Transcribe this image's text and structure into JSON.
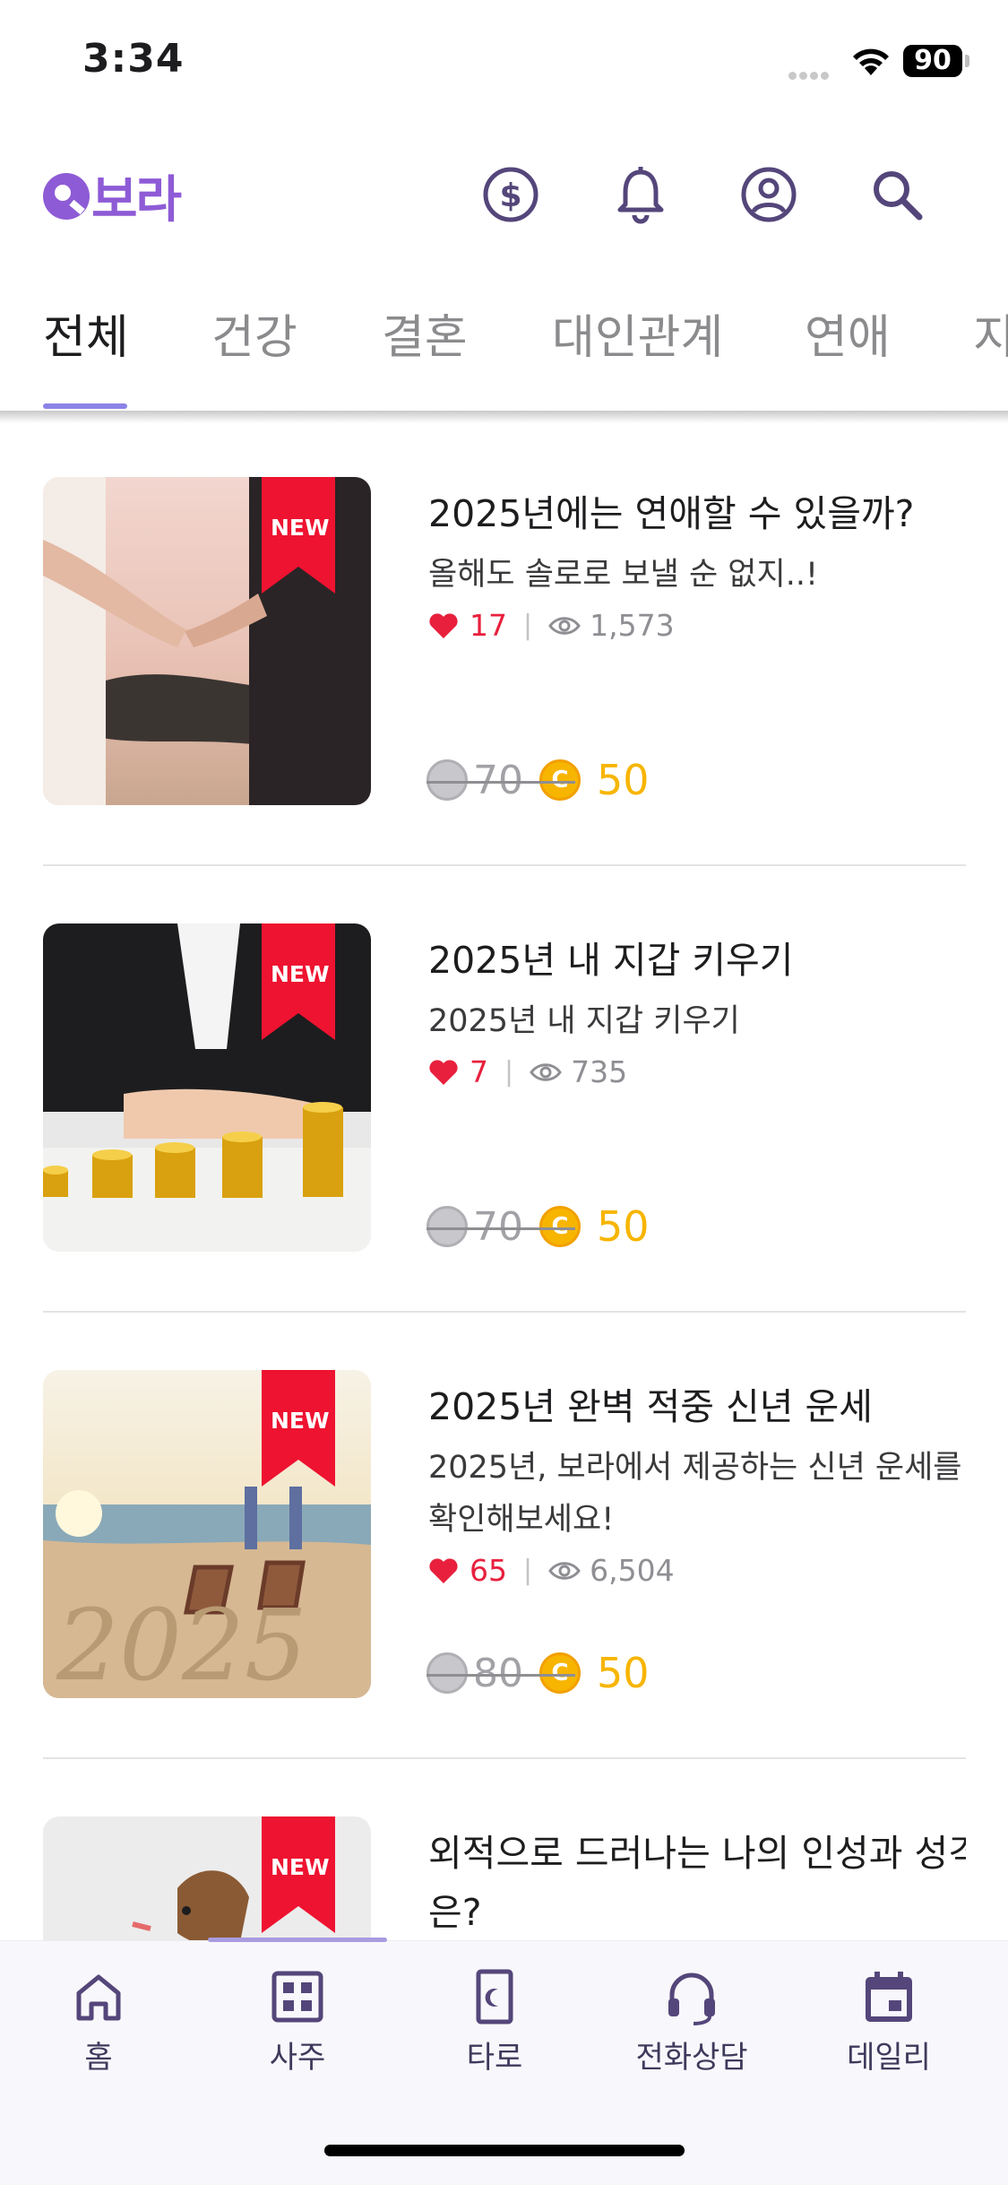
{
  "status_bar": {
    "time": "3:34",
    "battery": "90"
  },
  "header": {
    "logo_text": "보라",
    "brand_color": "#8e5bd6",
    "icons": [
      "coin-dollar-icon",
      "bell-icon",
      "profile-icon",
      "search-icon"
    ]
  },
  "tabs": [
    {
      "label": "전체",
      "active": true
    },
    {
      "label": "건강"
    },
    {
      "label": "결혼"
    },
    {
      "label": "대인관계"
    },
    {
      "label": "연애"
    },
    {
      "label": "지"
    }
  ],
  "items": [
    {
      "badge": "NEW",
      "title": "2025년에는 연애할 수 있을까?",
      "desc": "올해도 솔로로 보낼 순 없지..!",
      "likes": "17",
      "views": "1,573",
      "old_price": "70",
      "price": "50",
      "coin_letter": "C"
    },
    {
      "badge": "NEW",
      "title": "2025년 내 지갑 키우기",
      "desc": "2025년 내 지갑 키우기",
      "likes": "7",
      "views": "735",
      "old_price": "70",
      "price": "50",
      "coin_letter": "C"
    },
    {
      "badge": "NEW",
      "title": "2025년 완벽 적중 신년 운세",
      "desc": "2025년, 보라에서 제공하는 신년 운세를 확인해보세요!",
      "likes": "65",
      "views": "6,504",
      "old_price": "80",
      "price": "50",
      "coin_letter": "C"
    },
    {
      "badge": "NEW",
      "title": "외적으로 드러나는 나의 인성과 성격은?"
    }
  ],
  "bottom_nav": [
    {
      "label": "홈",
      "icon": "home-icon"
    },
    {
      "label": "사주",
      "icon": "grid-icon"
    },
    {
      "label": "타로",
      "icon": "tarot-card-icon"
    },
    {
      "label": "전화상담",
      "icon": "headset-icon"
    },
    {
      "label": "데일리",
      "icon": "calendar-icon"
    }
  ],
  "colors": {
    "accent": "#8b83e6",
    "like": "#e8203d",
    "coin": "#f7b500",
    "nav": "#54467a"
  }
}
